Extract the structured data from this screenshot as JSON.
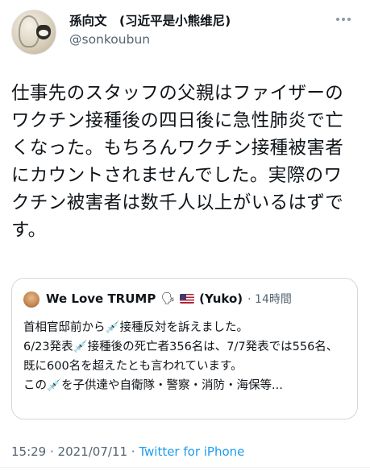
{
  "user": {
    "display_name": "孫向文　(习近平是小熊维尼)",
    "handle": "@sonkoubun"
  },
  "tweet": {
    "text": "仕事先のスタッフの父親はファイザーのワクチン接種後の四日後に急性肺炎で亡くなった。もちろんワクチン接種被害者にカウントされませんでした。実際のワクチン被害者は数千人以上がいるはずです。",
    "time": "15:29",
    "separator": " · ",
    "date": "2021/07/11",
    "source": "Twitter for iPhone"
  },
  "quote": {
    "author_name": "We Love TRUMP",
    "author_emoji": "🗣",
    "author_suffix": "(Yuko)",
    "time_ago": "· 14時間",
    "body": "首相官邸前から💉接種反対を訴えました。\n6/23発表💉接種後の死亡者356名は、7/7発表では556名、既に600名を超えたとも言われています。\nこの💉を子供達や自衛隊・警察・消防・海保等..."
  },
  "icons": {
    "avatar": "user-avatar",
    "more": "more-options-icon",
    "quote_avatar": "quoted-user-avatar",
    "flag": "us-flag-icon"
  },
  "colors": {
    "text": "#0f1419",
    "muted": "#536471",
    "link": "#1d9bf0",
    "border": "#cfd9de"
  }
}
